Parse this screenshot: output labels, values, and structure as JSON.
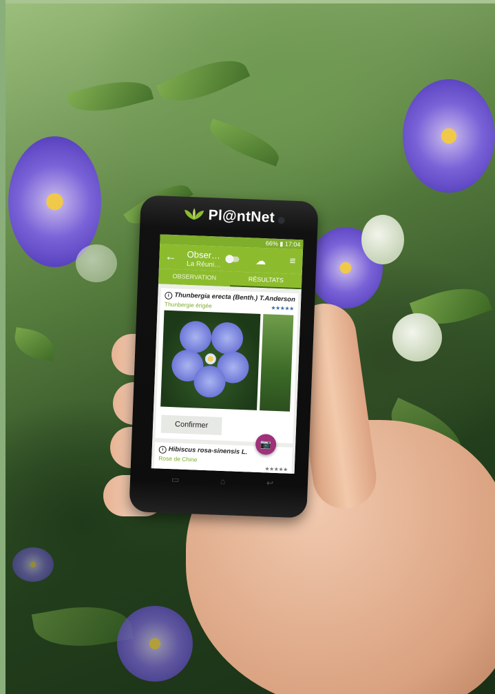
{
  "brand": {
    "name": "Pl@ntNet"
  },
  "statusbar": {
    "text": "66% ▮ 17:04"
  },
  "appbar": {
    "title": "Obser…",
    "subtitle": "La Réuni…"
  },
  "tabs": [
    {
      "label": "OBSERVATION",
      "active": false
    },
    {
      "label": "RÉSULTATS",
      "active": true
    }
  ],
  "results": [
    {
      "scientific_name": "Thunbergia erecta (Benth.) T.Anderson",
      "common_name": "Thunbergie érigée",
      "stars": "★★★★★",
      "rating": 5
    },
    {
      "scientific_name": "Hibiscus rosa-sinensis L.",
      "common_name": "Rose de Chine",
      "stars": "★★★★★"
    }
  ],
  "confirm_button": {
    "label": "Confirmer"
  },
  "colors": {
    "accent": "#8cbc2e",
    "fab": "#a0307a",
    "star": "#3a6ea8"
  },
  "icons": {
    "back": "arrow-left-icon",
    "upload": "cloud-upload-icon",
    "filter": "filter-icon",
    "camera": "add-photo-icon",
    "info": "info-icon"
  }
}
